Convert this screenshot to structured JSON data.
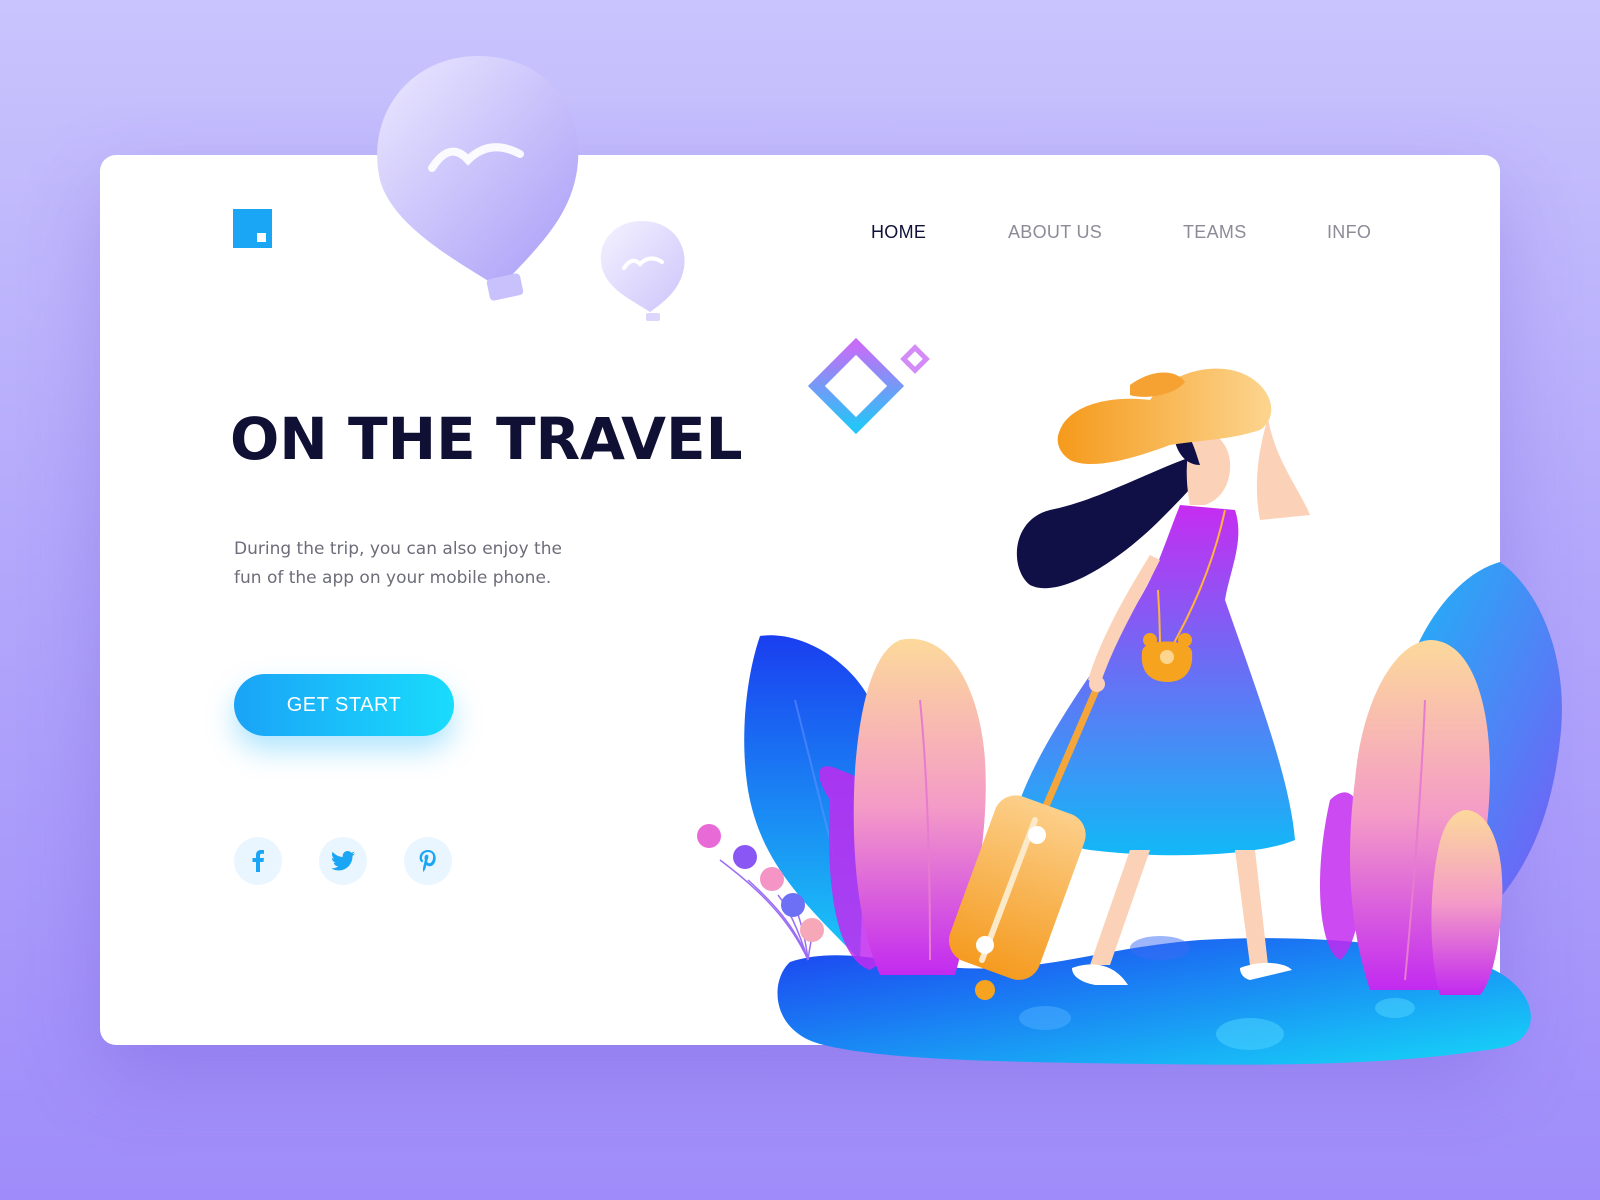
{
  "nav": {
    "items": [
      {
        "label": "HOME",
        "active": true
      },
      {
        "label": "ABOUT US",
        "active": false
      },
      {
        "label": "TEAMS",
        "active": false
      },
      {
        "label": "INFO",
        "active": false
      }
    ]
  },
  "hero": {
    "title": "ON THE TRAVEL",
    "subtitle": "During the trip, you can also enjoy the fun of the app on your mobile phone.",
    "cta_label": "GET START"
  },
  "social": [
    "facebook-icon",
    "twitter-icon",
    "pinterest-icon"
  ],
  "colors": {
    "accent": "#1aa6f5",
    "title": "#0f1034",
    "nav_active": "#10113a",
    "nav_inactive": "#8c8c99",
    "background": "#b3a8fb"
  }
}
